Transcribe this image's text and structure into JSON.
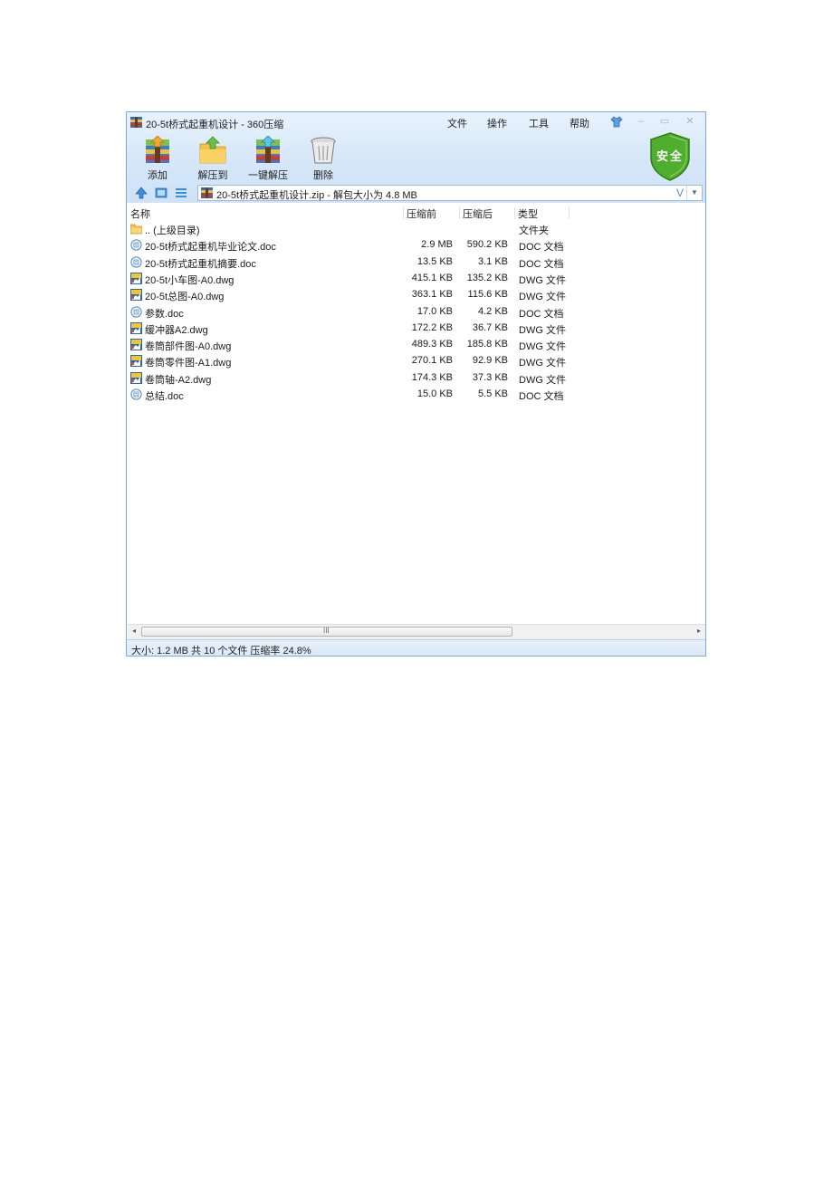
{
  "window": {
    "title": "20-5t桥式起重机设计 - 360压缩",
    "menu": [
      "文件",
      "操作",
      "工具",
      "帮助"
    ]
  },
  "toolbar": {
    "add_label": "添加",
    "extract_to_label": "解压到",
    "one_click_extract_label": "一键解压",
    "delete_label": "删除",
    "safe_badge": "安全"
  },
  "address": {
    "text": "20-5t桥式起重机设计.zip - 解包大小为 4.8 MB",
    "v_button": "V"
  },
  "columns": {
    "name": "名称",
    "original_size": "压缩前",
    "compressed_size": "压缩后",
    "type": "类型"
  },
  "files": [
    {
      "icon": "folder-icon",
      "name": ".. (上级目录)",
      "original": "",
      "compressed": "",
      "type": "文件夹"
    },
    {
      "icon": "doc-file-icon",
      "name": "20-5t桥式起重机毕业论文.doc",
      "original": "2.9 MB",
      "compressed": "590.2 KB",
      "type": "DOC 文档"
    },
    {
      "icon": "doc-file-icon",
      "name": "20-5t桥式起重机摘要.doc",
      "original": "13.5 KB",
      "compressed": "3.1 KB",
      "type": "DOC 文档"
    },
    {
      "icon": "dwg-file-icon",
      "name": "20-5t小车图-A0.dwg",
      "original": "415.1 KB",
      "compressed": "135.2 KB",
      "type": "DWG 文件"
    },
    {
      "icon": "dwg-file-icon",
      "name": "20-5t总图-A0.dwg",
      "original": "363.1 KB",
      "compressed": "115.6 KB",
      "type": "DWG 文件"
    },
    {
      "icon": "doc-file-icon",
      "name": "参数.doc",
      "original": "17.0 KB",
      "compressed": "4.2 KB",
      "type": "DOC 文档"
    },
    {
      "icon": "dwg-file-icon",
      "name": "缓冲器A2.dwg",
      "original": "172.2 KB",
      "compressed": "36.7 KB",
      "type": "DWG 文件"
    },
    {
      "icon": "dwg-file-icon",
      "name": "卷筒部件图-A0.dwg",
      "original": "489.3 KB",
      "compressed": "185.8 KB",
      "type": "DWG 文件"
    },
    {
      "icon": "dwg-file-icon",
      "name": "卷筒零件图-A1.dwg",
      "original": "270.1 KB",
      "compressed": "92.9 KB",
      "type": "DWG 文件"
    },
    {
      "icon": "dwg-file-icon",
      "name": "卷筒轴-A2.dwg",
      "original": "174.3 KB",
      "compressed": "37.3 KB",
      "type": "DWG 文件"
    },
    {
      "icon": "doc-file-icon",
      "name": "总结.doc",
      "original": "15.0 KB",
      "compressed": "5.5 KB",
      "type": "DOC 文档"
    }
  ],
  "scrollbar": {
    "grip": "III"
  },
  "status": {
    "text": "大小: 1.2 MB 共 10 个文件 压缩率 24.8%"
  }
}
